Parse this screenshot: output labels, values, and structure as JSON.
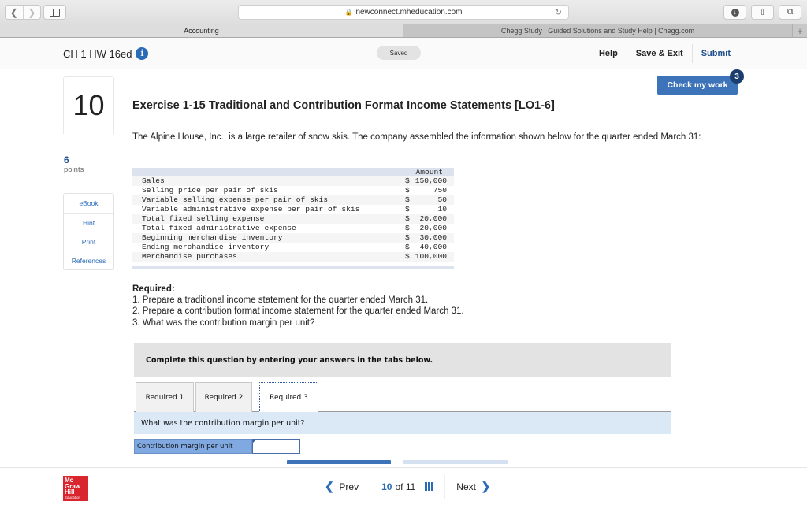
{
  "browser": {
    "url": "newconnect.mheducation.com",
    "tabs": [
      {
        "label": "Accounting",
        "active": true
      },
      {
        "label": "Chegg Study | Guided Solutions and Study Help | Chegg.com",
        "active": false
      }
    ],
    "new_tab_symbol": "+"
  },
  "header": {
    "assignment_title": "CH 1 HW 16ed",
    "info_icon": "i",
    "saved_status": "Saved",
    "links": {
      "help": "Help",
      "save_exit": "Save & Exit",
      "submit": "Submit"
    },
    "check_work": {
      "label": "Check my work",
      "badge": "3"
    }
  },
  "question": {
    "number": "10",
    "title": "Exercise 1-15 Traditional and Contribution Format Income Statements [LO1-6]",
    "points_value": "6",
    "points_label": "points",
    "tools": [
      "eBook",
      "Hint",
      "Print",
      "References"
    ],
    "intro": "The Alpine House, Inc., is a large retailer of snow skis. The company assembled the information shown below for the quarter ended March 31:",
    "table": {
      "header": "Amount",
      "rows": [
        {
          "label": "Sales",
          "dollar": "$",
          "value": "150,000"
        },
        {
          "label": "Selling price per pair of skis",
          "dollar": "$",
          "value": "750"
        },
        {
          "label": "Variable selling expense per pair of skis",
          "dollar": "$",
          "value": "50"
        },
        {
          "label": "Variable administrative expense per pair of skis",
          "dollar": "$",
          "value": "10"
        },
        {
          "label": "Total fixed selling expense",
          "dollar": "$",
          "value": "20,000"
        },
        {
          "label": "Total fixed administrative expense",
          "dollar": "$",
          "value": "20,000"
        },
        {
          "label": "Beginning merchandise inventory",
          "dollar": "$",
          "value": "30,000"
        },
        {
          "label": "Ending merchandise inventory",
          "dollar": "$",
          "value": "40,000"
        },
        {
          "label": "Merchandise purchases",
          "dollar": "$",
          "value": "100,000"
        }
      ]
    },
    "required_heading": "Required:",
    "required_items": [
      "1. Prepare a traditional income statement for the quarter ended March 31.",
      "2. Prepare a contribution format income statement for the quarter ended March 31.",
      "3. What was the contribution margin per unit?"
    ],
    "complete_instruction": "Complete this question by entering your answers in the tabs below.",
    "req_tabs": [
      "Required 1",
      "Required 2",
      "Required 3"
    ],
    "active_req_tab": "Required 3",
    "prompt": "What was the contribution margin per unit?",
    "answer": {
      "label": "Contribution margin per unit",
      "value": ""
    }
  },
  "footer": {
    "logo_lines": [
      "Mc",
      "Graw",
      "Hill"
    ],
    "logo_sub": "Education",
    "prev": "Prev",
    "current": "10",
    "of": "of",
    "total": "11",
    "next": "Next"
  },
  "colors": {
    "brand_blue": "#2a6bb8",
    "button_blue": "#3d73b8",
    "badge_navy": "#1b3e6e",
    "logo_red": "#d8252e"
  }
}
